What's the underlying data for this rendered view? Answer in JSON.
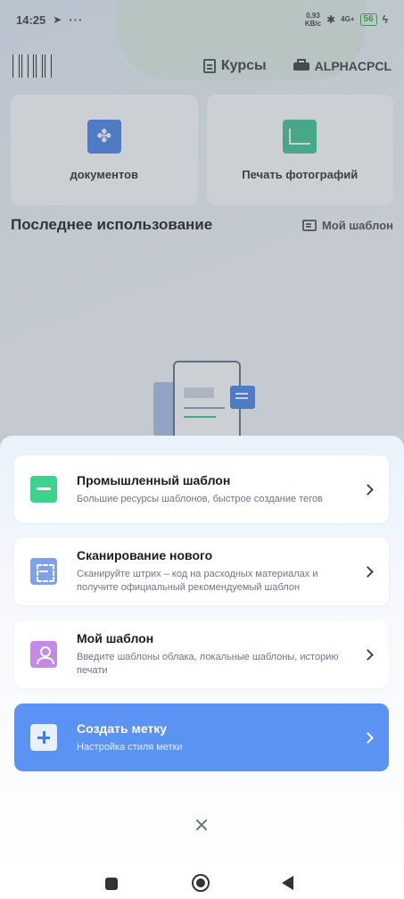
{
  "status_bar": {
    "time": "14:25",
    "telegram_icon": "telegram-icon",
    "more_dots": "···",
    "net_speed": "0,93",
    "net_unit": "KB/c",
    "bluetooth": "✱",
    "signal": "4G+",
    "battery": "56"
  },
  "header": {
    "courses_label": "Курсы",
    "printer_label": "ALPHACPCL"
  },
  "feature_cards": [
    {
      "label": "документов",
      "icon": "pdf-icon",
      "color": "#3f7de8"
    },
    {
      "label": "Печать фотографий",
      "icon": "photo-chart-icon",
      "color": "#34c28a"
    }
  ],
  "recent": {
    "title": "Последнее использование",
    "my_template_link": "Мой шаблон"
  },
  "sheet": {
    "options": [
      {
        "title": "Промышленный шаблон",
        "subtitle": "Большие ресурсы шаблонов, быстрое создание тегов",
        "icon": "industrial-template-icon",
        "color": "#3cd38f"
      },
      {
        "title": "Сканирование нового",
        "subtitle": "Сканируйте штрих – код на расходных материалах и получите официальный рекомендуемый шаблон",
        "icon": "scan-icon",
        "color": "#7ea2e8"
      },
      {
        "title": "Мой шаблон",
        "subtitle": "Введите шаблоны облака, локальные шаблоны, историю печати",
        "icon": "user-template-icon",
        "color": "#c38be6"
      }
    ],
    "create": {
      "title": "Создать метку",
      "subtitle": "Настройка стиля метки",
      "icon": "plus-icon",
      "color": "#5b93f5"
    },
    "close_icon": "close-icon"
  }
}
